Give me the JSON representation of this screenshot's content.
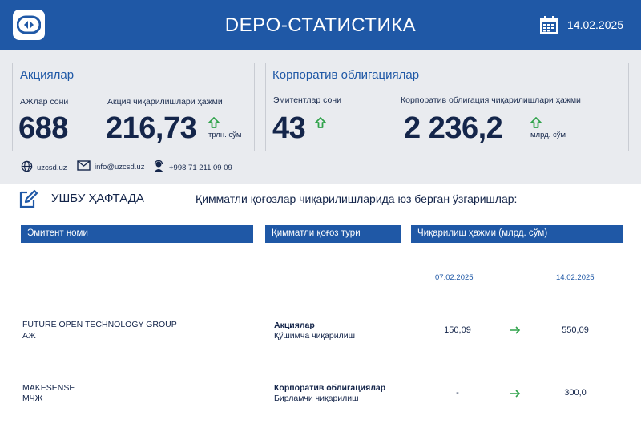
{
  "header": {
    "title": "DEPO-СТАТИСТИКА",
    "date": "14.02.2025",
    "logo_icon": "csd-logo-icon",
    "calendar_icon": "calendar-icon"
  },
  "stocks": {
    "title": "Акциялар",
    "count_label": "АЖлар сони",
    "count_value": "688",
    "volume_label": "Акция чиқарилишлари ҳажми",
    "volume_value": "216,73",
    "volume_unit": "трлн. сўм"
  },
  "bonds": {
    "title": "Корпоратив облигациялар",
    "count_label": "Эмитентлар сони",
    "count_value": "43",
    "volume_label": "Корпоратив облигация чиқарилишлари ҳажми",
    "volume_value": "2 236,2",
    "volume_unit": "млрд. сўм"
  },
  "contacts": {
    "web": "uzcsd.uz",
    "email": "info@uzcsd.uz",
    "phone": "+998 71 211 09 09"
  },
  "week": {
    "label": "УШБУ ҲАФТАДА",
    "description": "Қимматли қоғозлар чиқарилишларида юз берган ўзгаришлар:"
  },
  "table": {
    "headers": [
      "Эмитент номи",
      "Қимматли қоғоз тури",
      "Чиқарилиш ҳажми (млрд. сўм)"
    ],
    "date_prev": "07.02.2025",
    "date_curr": "14.02.2025",
    "rows": [
      {
        "issuer": "FUTURE OPEN TECHNOLOGY GROUP",
        "issuer_type": "АЖ",
        "security": "Акциялар",
        "issue_kind": "Қўшимча чиқарилиш",
        "prev": "150,09",
        "curr": "550,09"
      },
      {
        "issuer": "MAKESENSE",
        "issuer_type": "МЧЖ",
        "security": "Корпоратив облигациялар",
        "issue_kind": "Бирламчи чиқарилиш",
        "prev": "-",
        "curr": "300,0"
      }
    ]
  },
  "colors": {
    "brand_blue": "#1f58a6",
    "dark_navy": "#14254a",
    "up_green": "#2fa24a",
    "panel_bg": "#e9ebef"
  }
}
